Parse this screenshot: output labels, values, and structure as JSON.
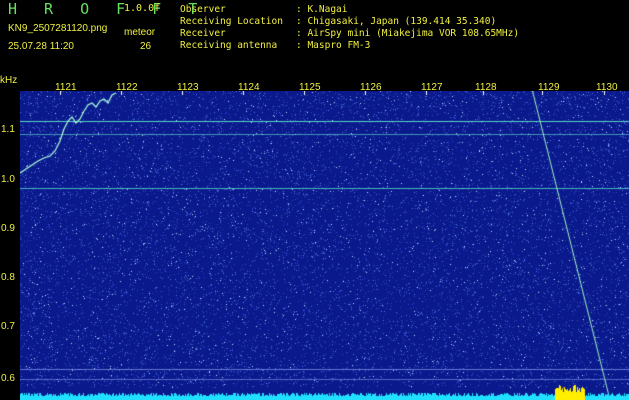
{
  "header": {
    "app_name": "H R O F F T",
    "version": "1.0.0f",
    "filename": "KN9_2507281120.png",
    "datetime": "25.07.28 11:20",
    "meteor_label": "meteor",
    "meteor_count": "26"
  },
  "info": [
    {
      "label": "Observer",
      "value": ": K.Nagai"
    },
    {
      "label": "Receiving Location",
      "value": ": Chigasaki, Japan (139.414 35.340)"
    },
    {
      "label": "Receiver",
      "value": ": AirSpy mini (Miakejima VOR 108.65MHz)"
    },
    {
      "label": "Receiving antenna",
      "value": ": Maspro FM-3"
    }
  ],
  "axis": {
    "y_unit": "kHz",
    "x_ticks": [
      "1121",
      "1122",
      "1123",
      "1124",
      "1125",
      "1126",
      "1127",
      "1128",
      "1129",
      "1130"
    ],
    "y_ticks": [
      "1.1",
      "1.0",
      "0.9",
      "0.8",
      "0.7",
      "0.6"
    ]
  },
  "colors": {
    "text": "#f0f040",
    "title": "#66e060",
    "background": "#000000",
    "spectrum_bg": "#0a1a8c",
    "noise": "#4f70e0",
    "signal": "#60e8d0",
    "baseline": "#20e0ff",
    "burst": "#ffee00"
  }
}
